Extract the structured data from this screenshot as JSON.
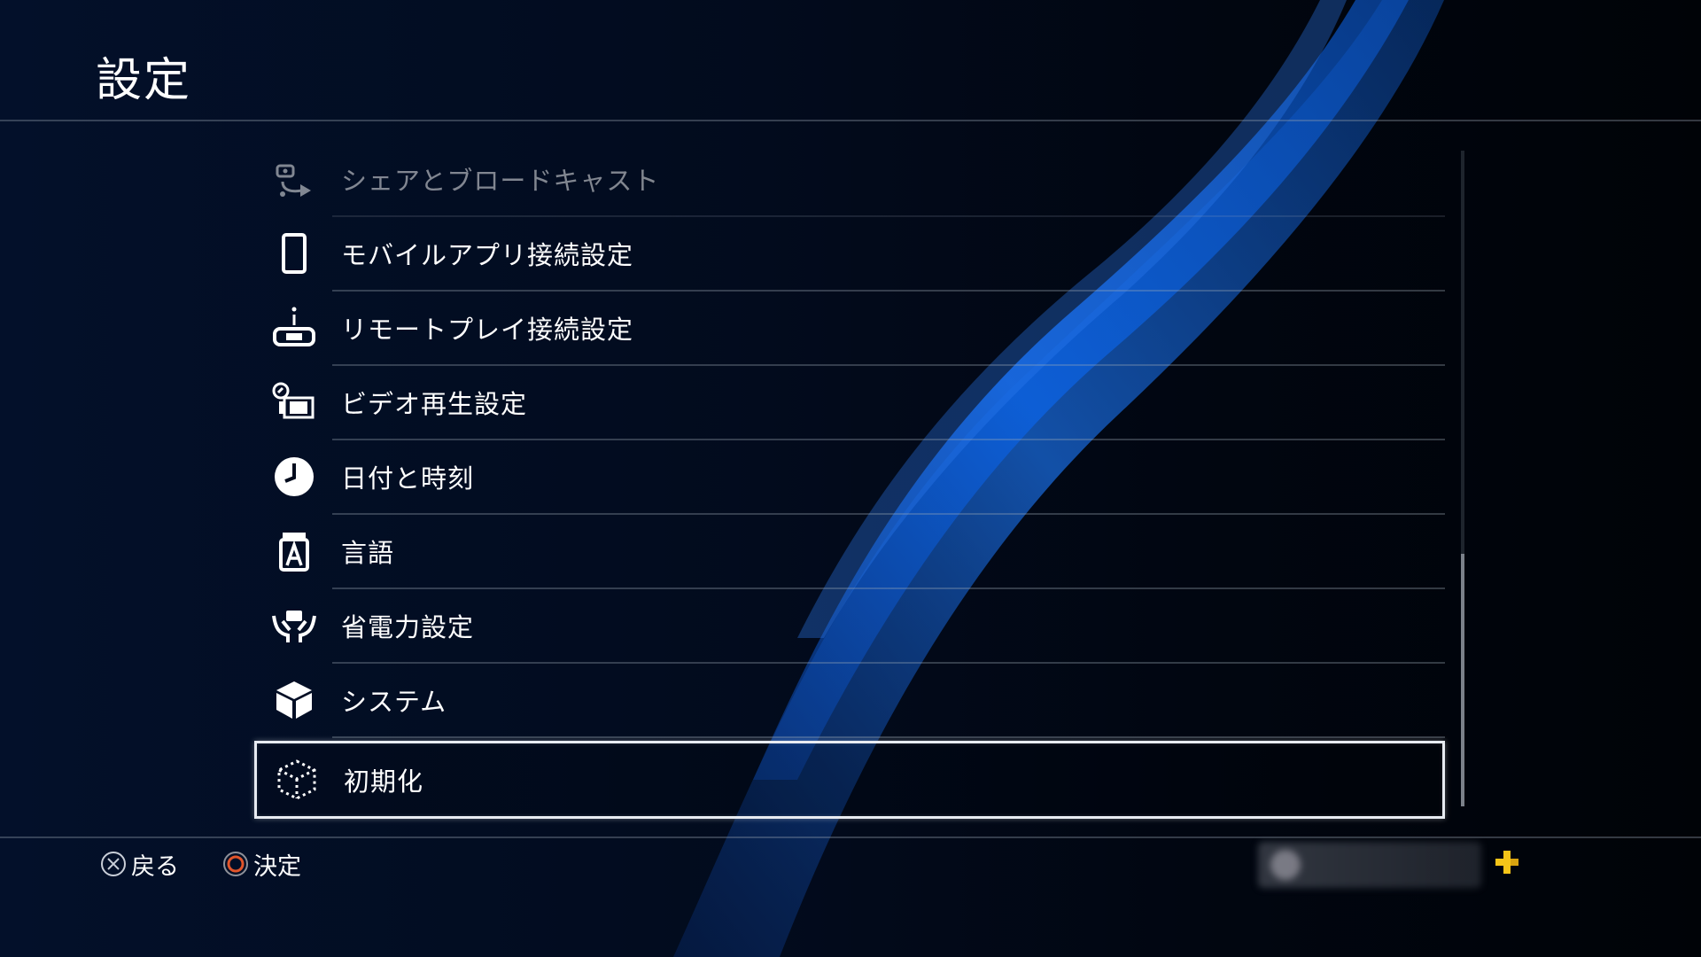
{
  "header": {
    "title": "設定"
  },
  "menu": {
    "items": [
      {
        "label": "シェアとブロードキャスト",
        "icon": "share-broadcast-icon",
        "state": "faded"
      },
      {
        "label": "モバイルアプリ接続設定",
        "icon": "mobile-phone-icon",
        "state": "normal"
      },
      {
        "label": "リモートプレイ接続設定",
        "icon": "remote-play-icon",
        "state": "normal"
      },
      {
        "label": "ビデオ再生設定",
        "icon": "video-playback-icon",
        "state": "normal"
      },
      {
        "label": "日付と時刻",
        "icon": "clock-icon",
        "state": "normal"
      },
      {
        "label": "言語",
        "icon": "language-icon",
        "state": "normal"
      },
      {
        "label": "省電力設定",
        "icon": "power-save-icon",
        "state": "normal"
      },
      {
        "label": "システム",
        "icon": "system-cube-icon",
        "state": "normal"
      },
      {
        "label": "初期化",
        "icon": "initialize-cube-icon",
        "state": "selected"
      }
    ]
  },
  "footer": {
    "back_label": "戻る",
    "back_icon": "cross-button-icon",
    "confirm_label": "決定",
    "confirm_icon": "circle-button-icon",
    "confirm_icon_color": "#e2552b",
    "plus_icon": "playstation-plus-icon",
    "plus_color": "#f5c518"
  },
  "colors": {
    "background": "#010a1c",
    "wave_blue": "#0a5fd6",
    "selection_border": "#e8ecf2"
  }
}
